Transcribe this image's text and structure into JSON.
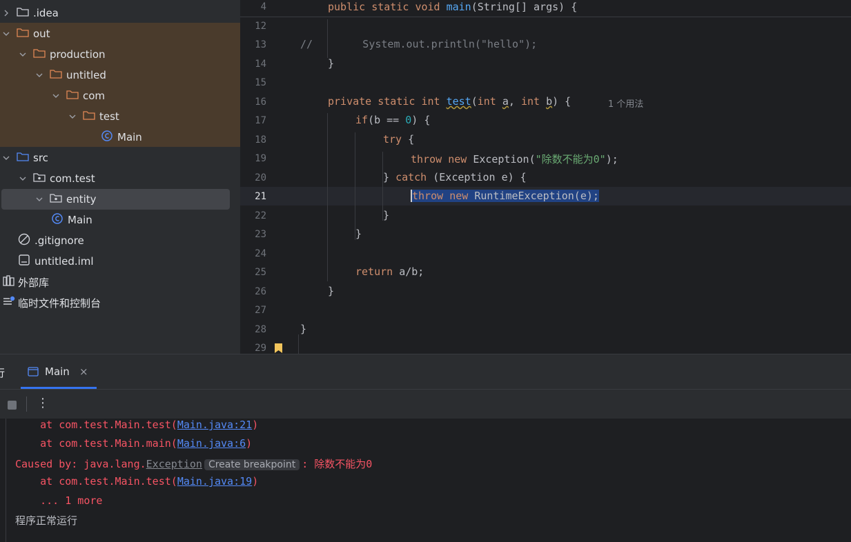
{
  "tree": {
    "items": [
      {
        "label": ".idea",
        "chev": "›",
        "icon": "folder"
      },
      {
        "label": "out",
        "chev": "⌄",
        "icon": "folder-orange"
      },
      {
        "label": "production",
        "chev": "⌄",
        "icon": "folder-orange"
      },
      {
        "label": "untitled",
        "chev": "⌄",
        "icon": "folder-orange"
      },
      {
        "label": "com",
        "chev": "⌄",
        "icon": "folder-orange"
      },
      {
        "label": "test",
        "chev": "⌄",
        "icon": "folder-orange"
      },
      {
        "label": "Main",
        "chev": "",
        "icon": "class"
      },
      {
        "label": "src",
        "chev": "⌄",
        "icon": "folder-blue"
      },
      {
        "label": "com.test",
        "chev": "⌄",
        "icon": "package"
      },
      {
        "label": "entity",
        "chev": "⌄",
        "icon": "package"
      },
      {
        "label": "Main",
        "chev": "",
        "icon": "class"
      },
      {
        "label": ".gitignore",
        "chev": "",
        "icon": "ignore"
      },
      {
        "label": "untitled.iml",
        "chev": "",
        "icon": "file"
      },
      {
        "label": "外部库",
        "chev": "",
        "icon": "library"
      },
      {
        "label": "临时文件和控制台",
        "chev": "",
        "icon": "scratch"
      }
    ]
  },
  "editor": {
    "sticky_line_number": "4",
    "line_numbers": [
      "12",
      "13",
      "14",
      "15",
      "16",
      "17",
      "18",
      "19",
      "20",
      "21",
      "22",
      "23",
      "24",
      "25",
      "26",
      "27",
      "28",
      "29"
    ],
    "current_line": "21",
    "inlay_hint": "1 个用法",
    "code": {
      "sticky": [
        "public",
        "static",
        "void",
        "main",
        "(String[] args) {"
      ],
      "l13_comment": "//",
      "l13_rest": "        System.out.println(\"hello\");",
      "l14": "}",
      "l16": [
        "private",
        "static",
        "int",
        "test",
        "(",
        "int",
        "a",
        "int",
        "b",
        ") {"
      ],
      "l17": [
        "if",
        "(b == ",
        "0",
        ") {"
      ],
      "l18": [
        "try",
        " {"
      ],
      "l19": [
        "throw",
        "new",
        "Exception(",
        "\"除数不能为0\"",
        ");"
      ],
      "l20": [
        "} ",
        "catch",
        " (Exception e) {"
      ],
      "l21": [
        "throw",
        "new",
        "RuntimeException(e);"
      ],
      "l22": "}",
      "l23": "}",
      "l25": [
        "return",
        " a/b;"
      ],
      "l26": "}",
      "l28": "}"
    }
  },
  "bottom": {
    "left_tab_fragment": "行",
    "tab_label": "Main",
    "tooltip": "Create breakpoint",
    "console": [
      {
        "pre": "    at com.test.Main.test(",
        "link": "Main.java:21",
        "post": ")"
      },
      {
        "pre": "    at com.test.Main.main(",
        "link": "Main.java:6",
        "post": ")"
      },
      {
        "pre": "Caused by: java.lang.",
        "link": "Exception",
        "post": ": 除数不能为0"
      },
      {
        "pre": "    at com.test.Main.test(",
        "link": "Main.java:19",
        "post": ")"
      },
      {
        "pre": "    ... 1 more",
        "link": "",
        "post": ""
      }
    ],
    "normal_output": "程序正常运行"
  },
  "colors": {
    "keyword": "#cf8e6d",
    "function": "#56a8f5",
    "string": "#6aab73",
    "number": "#2aacb8",
    "error": "#f75464",
    "link": "#548af7"
  }
}
